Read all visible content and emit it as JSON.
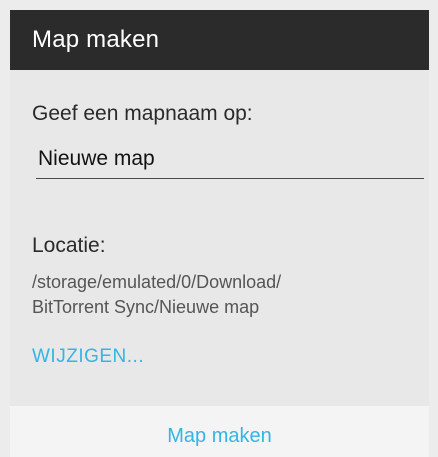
{
  "dialog": {
    "title": "Map maken",
    "prompt_label": "Geef een mapnaam op:",
    "folder_name_value": "Nieuwe map",
    "location_label": "Locatie:",
    "location_path": "/storage/emulated/0/Download/\nBitTorrent Sync/Nieuwe map",
    "change_label": "WIJZIGEN...",
    "create_button_label": "Map maken"
  },
  "colors": {
    "title_bar": "#2b2b2b",
    "accent": "#33b5e5",
    "background": "#e8e8e8"
  }
}
